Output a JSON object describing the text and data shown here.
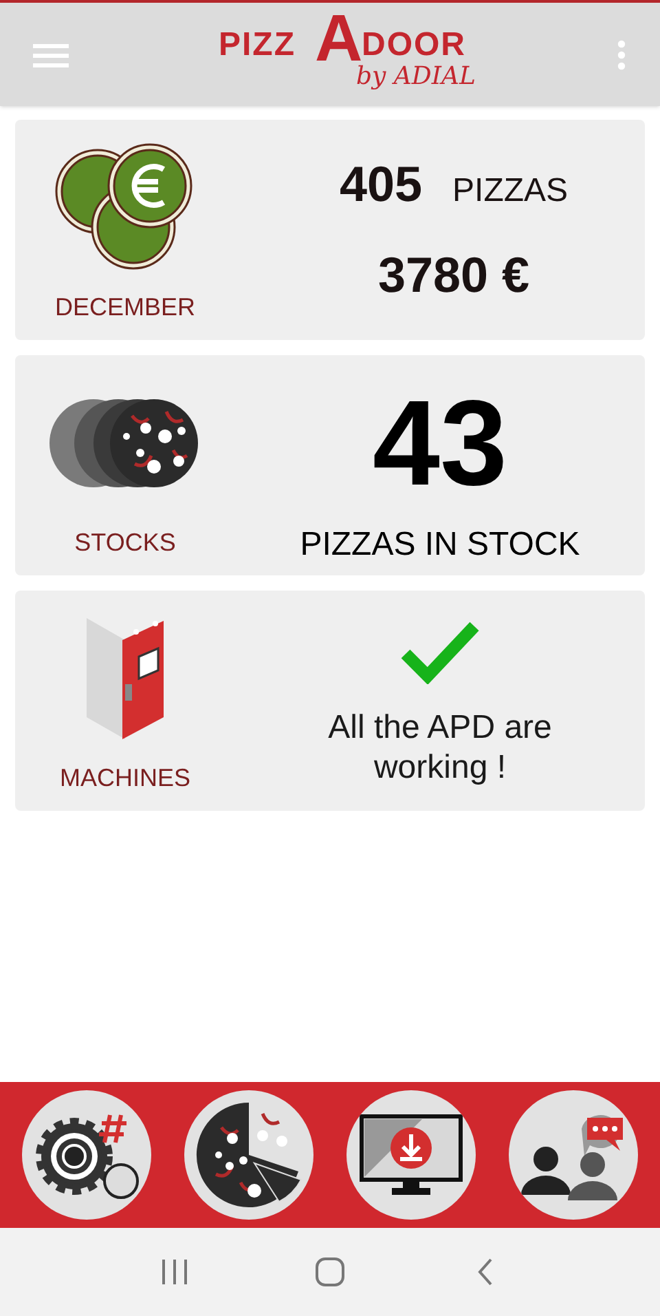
{
  "logo": {
    "left": "PIZZ",
    "big_letter": "A",
    "right": "DOOR",
    "tagline": "by ADIAL"
  },
  "cards": [
    {
      "kind": "sales",
      "label": "DECEMBER",
      "count": "405",
      "count_unit": "PIZZAS",
      "amount": "3780 €"
    },
    {
      "kind": "stock",
      "label": "STOCKS",
      "count": "43",
      "caption": "PIZZAS IN STOCK"
    },
    {
      "kind": "machines",
      "label": "MACHINES",
      "all_working": true,
      "message": "All the APD are working !"
    }
  ],
  "bottom_nav": [
    {
      "kind": "settings"
    },
    {
      "kind": "pizza"
    },
    {
      "kind": "download"
    },
    {
      "kind": "contact"
    }
  ]
}
